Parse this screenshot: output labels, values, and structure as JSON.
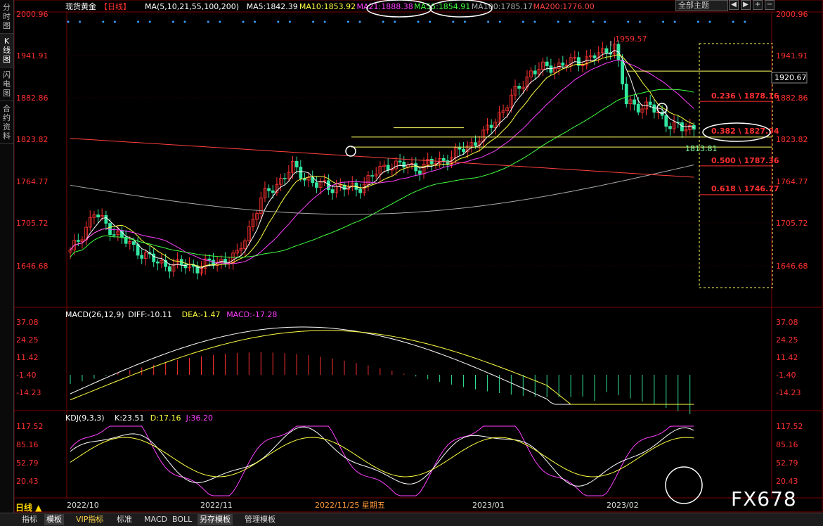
{
  "sidebar": {
    "tabs": [
      {
        "label": "分时图",
        "active": false
      },
      {
        "label": "K线图",
        "active": true
      },
      {
        "label": "闪电图",
        "active": false
      },
      {
        "label": "合约资料",
        "active": false
      }
    ]
  },
  "header": {
    "title": "现货黄金",
    "period": "【日线】",
    "legend": [
      {
        "text": "MA(5,10,21,55,100,200)",
        "color": "#ffffff"
      },
      {
        "text": "MA5:1842.39",
        "color": "#ffffff"
      },
      {
        "text": "MA10:1853.92",
        "color": "#ffff40"
      },
      {
        "text": "MA21:1888.38",
        "color": "#ff40ff"
      },
      {
        "text": "MA55:1854.91",
        "color": "#40ff40"
      },
      {
        "text": "MA100:1785.17",
        "color": "#aaaaaa"
      },
      {
        "text": "MA200:1776.00",
        "color": "#ff4040"
      }
    ],
    "theme_button": "全部主题",
    "win_controls": [
      "◀",
      "▶",
      "+",
      "−"
    ]
  },
  "price_axis": {
    "labels": [
      "2000.96",
      "1941.91",
      "1882.86",
      "1823.82",
      "1764.77",
      "1705.72",
      "1646.68"
    ]
  },
  "annotations": {
    "high_label": "1959.57",
    "low_label": "1813.81",
    "level_label": "1920.67",
    "fib": [
      {
        "ratio": "0.236",
        "value": "1878.16"
      },
      {
        "ratio": "0.382",
        "value": "1827.94"
      },
      {
        "ratio": "0.500",
        "value": "1787.36"
      },
      {
        "ratio": "0.618",
        "value": "1746.77"
      }
    ]
  },
  "macd": {
    "legend": [
      {
        "text": "MACD(26,12,9)",
        "color": "#ffffff"
      },
      {
        "text": "DIFF:-10.11",
        "color": "#ffffff"
      },
      {
        "text": "DEA:-1.47",
        "color": "#ffff40"
      },
      {
        "text": "MACD:-17.28",
        "color": "#ff40ff"
      }
    ],
    "axis": [
      "37.08",
      "24.25",
      "11.42",
      "-1.40",
      "-14.23"
    ]
  },
  "kdj": {
    "legend": [
      {
        "text": "KDJ(9,3,3)",
        "color": "#ffffff"
      },
      {
        "text": "K:23.51",
        "color": "#ffffff"
      },
      {
        "text": "D:17.16",
        "color": "#ffff40"
      },
      {
        "text": "J:36.20",
        "color": "#ff40ff"
      }
    ],
    "axis": [
      "117.52",
      "85.16",
      "52.79",
      "20.43"
    ]
  },
  "x_axis": {
    "labels": [
      "2022/10",
      "2022/11",
      "2022/11/25 星期五",
      "2023/01",
      "2023/02"
    ]
  },
  "period_button": "日线 ▲",
  "bottom_tabs": [
    "指标",
    "模板",
    "VIP指标",
    "标准",
    "MACD",
    "BOLL",
    "另存模板",
    "管理模板"
  ],
  "watermark": "FX678",
  "colors": {
    "up": "#ff3232",
    "down": "#32e6a0",
    "grid": "#7a0000",
    "axis_text": "#ff3030"
  }
}
